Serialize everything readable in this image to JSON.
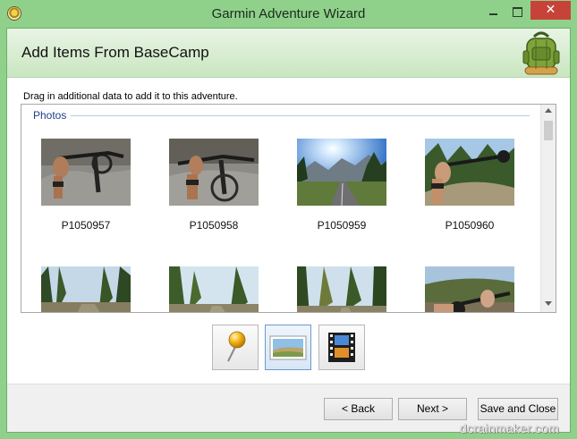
{
  "window": {
    "title": "Garmin Adventure Wizard",
    "close_glyph": "✕"
  },
  "header": {
    "title": "Add Items From BaseCamp",
    "icon": "backpack-icon"
  },
  "instruction": "Drag in additional data to add it to this adventure.",
  "photos_section": {
    "label": "Photos",
    "items": [
      {
        "name": "P1050957"
      },
      {
        "name": "P1050958"
      },
      {
        "name": "P1050959"
      },
      {
        "name": "P1050960"
      },
      {
        "name": ""
      },
      {
        "name": ""
      },
      {
        "name": ""
      },
      {
        "name": ""
      }
    ]
  },
  "type_buttons": [
    {
      "icon": "waypoint-pin-icon",
      "selected": false
    },
    {
      "icon": "photo-icon",
      "selected": true
    },
    {
      "icon": "video-icon",
      "selected": false
    }
  ],
  "footer": {
    "back_label": "< Back",
    "next_label": "Next >",
    "save_close_label": "Save and Close"
  },
  "watermark": "dcrainmaker.com",
  "colors": {
    "frame": "#8fd18a",
    "header_top": "#e9f4e5",
    "header_bottom": "#c9e6c0",
    "section_label": "#1e3f8c",
    "close_button": "#c7433a",
    "selected_button_border": "#6c9ac8"
  }
}
